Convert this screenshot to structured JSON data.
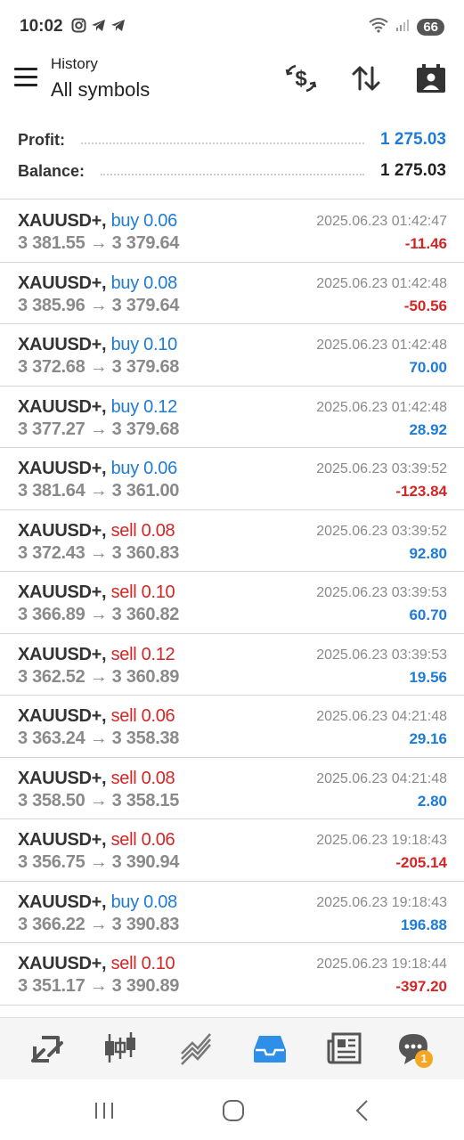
{
  "status_bar": {
    "time": "10:02",
    "battery": "66",
    "icons": [
      "instagram-icon",
      "telegram-icon",
      "telegram-icon",
      "wifi-icon",
      "signal-icon"
    ]
  },
  "header": {
    "title": "History",
    "subtitle": "All symbols",
    "icons": [
      "currency-icon",
      "sort-icon",
      "calendar-icon"
    ]
  },
  "summary": {
    "profit_label": "Profit:",
    "profit_value": "1 275.03",
    "balance_label": "Balance:",
    "balance_value": "1 275.03"
  },
  "trades": [
    {
      "symbol": "XAUUSD+,",
      "side": "buy 0.06",
      "type": "buy",
      "prices": "3 381.55 → 3 379.64",
      "date": "2025.06.23 01:42:47",
      "profit": "-11.46",
      "sign": "neg"
    },
    {
      "symbol": "XAUUSD+,",
      "side": "buy 0.08",
      "type": "buy",
      "prices": "3 385.96 → 3 379.64",
      "date": "2025.06.23 01:42:48",
      "profit": "-50.56",
      "sign": "neg"
    },
    {
      "symbol": "XAUUSD+,",
      "side": "buy 0.10",
      "type": "buy",
      "prices": "3 372.68 → 3 379.68",
      "date": "2025.06.23 01:42:48",
      "profit": "70.00",
      "sign": "pos"
    },
    {
      "symbol": "XAUUSD+,",
      "side": "buy 0.12",
      "type": "buy",
      "prices": "3 377.27 → 3 379.68",
      "date": "2025.06.23 01:42:48",
      "profit": "28.92",
      "sign": "pos"
    },
    {
      "symbol": "XAUUSD+,",
      "side": "buy 0.06",
      "type": "buy",
      "prices": "3 381.64 → 3 361.00",
      "date": "2025.06.23 03:39:52",
      "profit": "-123.84",
      "sign": "neg"
    },
    {
      "symbol": "XAUUSD+,",
      "side": "sell 0.08",
      "type": "sell",
      "prices": "3 372.43 → 3 360.83",
      "date": "2025.06.23 03:39:52",
      "profit": "92.80",
      "sign": "pos"
    },
    {
      "symbol": "XAUUSD+,",
      "side": "sell 0.10",
      "type": "sell",
      "prices": "3 366.89 → 3 360.82",
      "date": "2025.06.23 03:39:53",
      "profit": "60.70",
      "sign": "pos"
    },
    {
      "symbol": "XAUUSD+,",
      "side": "sell 0.12",
      "type": "sell",
      "prices": "3 362.52 → 3 360.89",
      "date": "2025.06.23 03:39:53",
      "profit": "19.56",
      "sign": "pos"
    },
    {
      "symbol": "XAUUSD+,",
      "side": "sell 0.06",
      "type": "sell",
      "prices": "3 363.24 → 3 358.38",
      "date": "2025.06.23 04:21:48",
      "profit": "29.16",
      "sign": "pos"
    },
    {
      "symbol": "XAUUSD+,",
      "side": "sell 0.08",
      "type": "sell",
      "prices": "3 358.50 → 3 358.15",
      "date": "2025.06.23 04:21:48",
      "profit": "2.80",
      "sign": "pos"
    },
    {
      "symbol": "XAUUSD+,",
      "side": "sell 0.06",
      "type": "sell",
      "prices": "3 356.75 → 3 390.94",
      "date": "2025.06.23 19:18:43",
      "profit": "-205.14",
      "sign": "neg"
    },
    {
      "symbol": "XAUUSD+,",
      "side": "buy 0.08",
      "type": "buy",
      "prices": "3 366.22 → 3 390.83",
      "date": "2025.06.23 19:18:43",
      "profit": "196.88",
      "sign": "pos"
    },
    {
      "symbol": "XAUUSD+,",
      "side": "sell 0.10",
      "type": "sell",
      "prices": "3 351.17 → 3 390.89",
      "date": "2025.06.23 19:18:44",
      "profit": "-397.20",
      "sign": "neg"
    }
  ],
  "bottom_nav": {
    "items": [
      "trade-icon",
      "chart-icon",
      "trends-icon",
      "history-icon",
      "news-icon",
      "chat-icon"
    ],
    "active": "history-icon",
    "chat_badge": "1"
  },
  "colors": {
    "positive": "#1e7bd6",
    "negative": "#d32626",
    "muted": "#8a8a8a"
  }
}
